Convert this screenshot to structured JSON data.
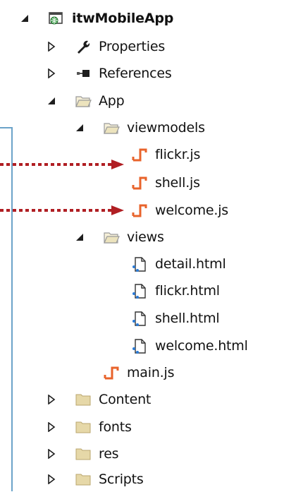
{
  "tree": {
    "project": {
      "label": "itwMobileApp",
      "icon": "web-project-icon",
      "expanded": true
    },
    "items": [
      {
        "key": "properties",
        "label": "Properties",
        "icon": "wrench-icon",
        "expander": "collapsed"
      },
      {
        "key": "references",
        "label": "References",
        "icon": "references-icon",
        "expander": "collapsed"
      },
      {
        "key": "app",
        "label": "App",
        "icon": "folder-open-icon",
        "expander": "expanded"
      },
      {
        "key": "viewmodels",
        "label": "viewmodels",
        "icon": "folder-open-icon",
        "expander": "expanded"
      },
      {
        "key": "flickr-js",
        "label": "flickr.js",
        "icon": "js-file-icon",
        "expander": "none"
      },
      {
        "key": "shell-js",
        "label": "shell.js",
        "icon": "js-file-icon",
        "expander": "none"
      },
      {
        "key": "welcome-js",
        "label": "welcome.js",
        "icon": "js-file-icon",
        "expander": "none"
      },
      {
        "key": "views",
        "label": "views",
        "icon": "folder-open-icon",
        "expander": "expanded"
      },
      {
        "key": "detail-html",
        "label": "detail.html",
        "icon": "html-file-icon",
        "expander": "none"
      },
      {
        "key": "flickr-html",
        "label": "flickr.html",
        "icon": "html-file-icon",
        "expander": "none"
      },
      {
        "key": "shell-html",
        "label": "shell.html",
        "icon": "html-file-icon",
        "expander": "none"
      },
      {
        "key": "welcome-html",
        "label": "welcome.html",
        "icon": "html-file-icon",
        "expander": "none"
      },
      {
        "key": "main-js",
        "label": "main.js",
        "icon": "js-file-icon",
        "expander": "none"
      },
      {
        "key": "content",
        "label": "Content",
        "icon": "folder-closed-icon",
        "expander": "collapsed"
      },
      {
        "key": "fonts",
        "label": "fonts",
        "icon": "folder-closed-icon",
        "expander": "collapsed"
      },
      {
        "key": "res",
        "label": "res",
        "icon": "folder-closed-icon",
        "expander": "collapsed"
      },
      {
        "key": "scripts",
        "label": "Scripts",
        "icon": "folder-closed-icon",
        "expander": "collapsed"
      }
    ]
  },
  "annotations": {
    "arrow_targets": [
      "flickr-js",
      "welcome-js"
    ],
    "arrow_color": "#b01e23"
  },
  "colors": {
    "js_icon": "#e8632b",
    "folder": "#e6d8a8",
    "folder_stroke": "#b9a66e",
    "frame": "#6ba3c9"
  }
}
